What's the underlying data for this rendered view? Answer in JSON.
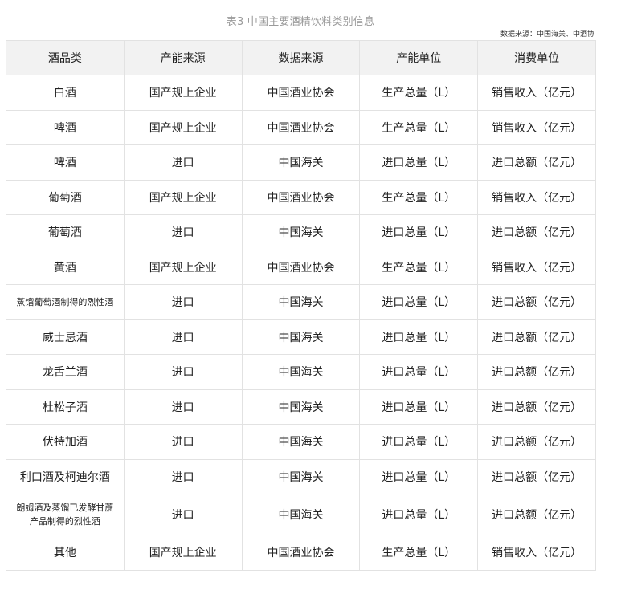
{
  "title": "表3 中国主要酒精饮料类别信息",
  "source": "数据来源：中国海关、中酒协",
  "table": {
    "headers": [
      "酒品类",
      "产能来源",
      "数据来源",
      "产能单位",
      "消费单位"
    ],
    "rows": [
      [
        "白酒",
        "国产规上企业",
        "中国酒业协会",
        "生产总量（L）",
        "销售收入（亿元）"
      ],
      [
        "啤酒",
        "国产规上企业",
        "中国酒业协会",
        "生产总量（L）",
        "销售收入（亿元）"
      ],
      [
        "啤酒",
        "进口",
        "中国海关",
        "进口总量（L）",
        "进口总额（亿元）"
      ],
      [
        "葡萄酒",
        "国产规上企业",
        "中国酒业协会",
        "生产总量（L）",
        "销售收入（亿元）"
      ],
      [
        "葡萄酒",
        "进口",
        "中国海关",
        "进口总量（L）",
        "进口总额（亿元）"
      ],
      [
        "黄酒",
        "国产规上企业",
        "中国酒业协会",
        "生产总量（L）",
        "销售收入（亿元）"
      ],
      [
        "蒸馏葡萄酒制得的烈性酒",
        "进口",
        "中国海关",
        "进口总量（L）",
        "进口总额（亿元）"
      ],
      [
        "威士忌酒",
        "进口",
        "中国海关",
        "进口总量（L）",
        "进口总额（亿元）"
      ],
      [
        "龙舌兰酒",
        "进口",
        "中国海关",
        "进口总量（L）",
        "进口总额（亿元）"
      ],
      [
        "杜松子酒",
        "进口",
        "中国海关",
        "进口总量（L）",
        "进口总额（亿元）"
      ],
      [
        "伏特加酒",
        "进口",
        "中国海关",
        "进口总量（L）",
        "进口总额（亿元）"
      ],
      [
        "利口酒及柯迪尔酒",
        "进口",
        "中国海关",
        "进口总量（L）",
        "进口总额（亿元）"
      ],
      [
        "朗姆酒及蒸馏已发酵甘蔗产品制得的烈性酒",
        "进口",
        "中国海关",
        "进口总量（L）",
        "进口总额（亿元）"
      ],
      [
        "其他",
        "国产规上企业",
        "中国酒业协会",
        "生产总量（L）",
        "销售收入（亿元）"
      ]
    ]
  }
}
